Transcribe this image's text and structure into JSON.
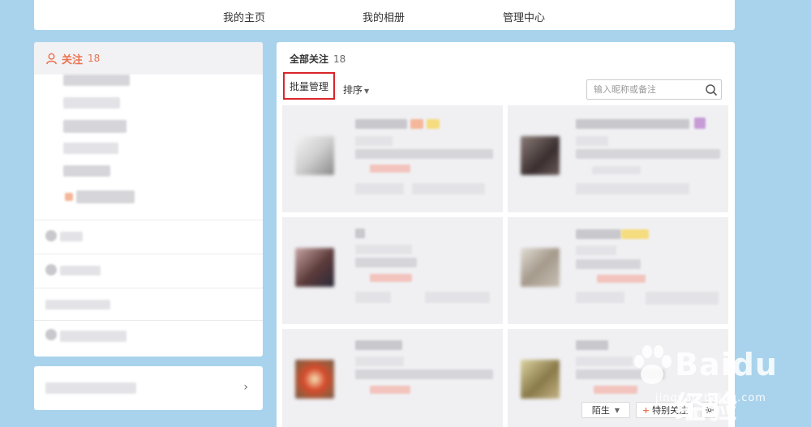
{
  "topnav": {
    "items": [
      {
        "label": "我的主页"
      },
      {
        "label": "我的相册"
      },
      {
        "label": "管理中心"
      }
    ]
  },
  "sidebar": {
    "follow_label": "关注",
    "follow_count": "18",
    "accent_color": "#eb7350"
  },
  "main": {
    "title": "全部关注",
    "count": "18",
    "batch_label": "批量管理",
    "sort_label": "排序",
    "search_placeholder": "输入昵称或备注",
    "card_status": "陌生",
    "card_special_follow": "特别关注"
  },
  "watermark": {
    "brand": "Baidu 经验",
    "url": "jingyan.baidu.com"
  },
  "icons": [
    "person-icon",
    "gear-icon",
    "search-icon",
    "chevron-right-icon",
    "plus-icon"
  ]
}
